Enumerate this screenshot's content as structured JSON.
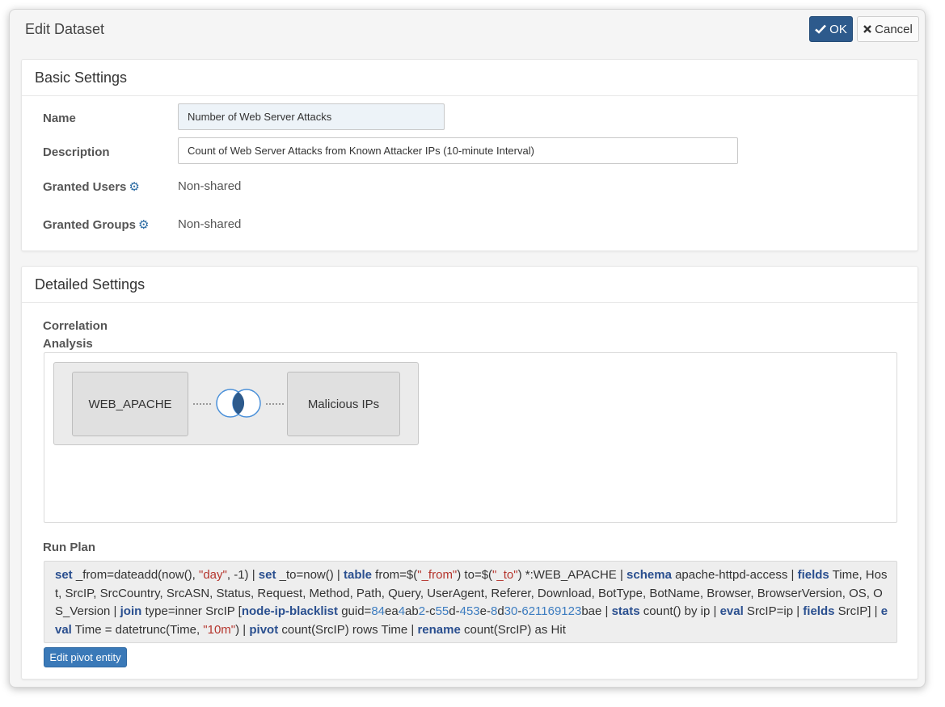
{
  "dialog": {
    "title": "Edit Dataset",
    "ok_label": "OK",
    "cancel_label": "Cancel"
  },
  "basic": {
    "heading": "Basic Settings",
    "name_label": "Name",
    "name_value": "Number of Web Server Attacks",
    "description_label": "Description",
    "description_value": "Count of Web Server Attacks from Known Attacker IPs (10-minute Interval)",
    "granted_users_label": "Granted Users",
    "granted_users_value": "Non-shared",
    "granted_groups_label": "Granted Groups",
    "granted_groups_value": "Non-shared"
  },
  "detailed": {
    "heading": "Detailed Settings",
    "correlation_label_1": "Correlation",
    "correlation_label_2": "Analysis",
    "left_source": "WEB_APACHE",
    "right_source": "Malicious IPs",
    "run_plan_label": "Run Plan",
    "run_plan_segments": [
      {
        "t": "set",
        "k": "kw"
      },
      {
        "t": " _from=dateadd(now(), ",
        "k": ""
      },
      {
        "t": "\"day\"",
        "k": "str"
      },
      {
        "t": ", -1) | ",
        "k": ""
      },
      {
        "t": "set",
        "k": "kw"
      },
      {
        "t": " _to=now() | ",
        "k": ""
      },
      {
        "t": "table",
        "k": "kw"
      },
      {
        "t": " from=$(",
        "k": ""
      },
      {
        "t": "\"_from\"",
        "k": "str"
      },
      {
        "t": ") to=$(",
        "k": ""
      },
      {
        "t": "\"_to\"",
        "k": "str"
      },
      {
        "t": ") *:WEB_APACHE | ",
        "k": ""
      },
      {
        "t": "schema",
        "k": "kw"
      },
      {
        "t": " apache-httpd-access | ",
        "k": ""
      },
      {
        "t": "fields",
        "k": "kw"
      },
      {
        "t": " Time, Host, SrcIP, SrcCountry, SrcASN, Status, Request, Method, Path, Query, UserAgent, Referer, Download, BotType, BotName, Browser, BrowserVersion, OS, OS_Version  | ",
        "k": ""
      },
      {
        "t": "join",
        "k": "kw"
      },
      {
        "t": " type=inner SrcIP [",
        "k": ""
      },
      {
        "t": "node-ip-blacklist",
        "k": "kw"
      },
      {
        "t": " guid=",
        "k": ""
      },
      {
        "t": "84",
        "k": "num"
      },
      {
        "t": "ea",
        "k": ""
      },
      {
        "t": "4",
        "k": "num"
      },
      {
        "t": "ab",
        "k": ""
      },
      {
        "t": "2",
        "k": "num"
      },
      {
        "t": "-c",
        "k": ""
      },
      {
        "t": "55",
        "k": "num"
      },
      {
        "t": "d-",
        "k": ""
      },
      {
        "t": "453",
        "k": "num"
      },
      {
        "t": "e-",
        "k": ""
      },
      {
        "t": "8",
        "k": "num"
      },
      {
        "t": "d",
        "k": ""
      },
      {
        "t": "30",
        "k": "num"
      },
      {
        "t": "-",
        "k": ""
      },
      {
        "t": "621169123",
        "k": "num"
      },
      {
        "t": "bae | ",
        "k": ""
      },
      {
        "t": "stats",
        "k": "kw"
      },
      {
        "t": " count() by ip | ",
        "k": ""
      },
      {
        "t": "eval",
        "k": "kw"
      },
      {
        "t": " SrcIP=ip | ",
        "k": ""
      },
      {
        "t": "fields",
        "k": "kw"
      },
      {
        "t": " SrcIP] | ",
        "k": ""
      },
      {
        "t": "eval",
        "k": "kw"
      },
      {
        "t": " Time = datetrunc(Time, ",
        "k": ""
      },
      {
        "t": "\"10m\"",
        "k": "str"
      },
      {
        "t": ")  | ",
        "k": ""
      },
      {
        "t": "pivot",
        "k": "kw"
      },
      {
        "t": " count(SrcIP) rows Time | ",
        "k": ""
      },
      {
        "t": "rename",
        "k": "kw"
      },
      {
        "t": " count(SrcIP) as Hit",
        "k": ""
      }
    ],
    "edit_pivot_label": "Edit pivot entity"
  },
  "colors": {
    "primary": "#2d5a8c",
    "keyword": "#2a4f8f",
    "string": "#b5352d",
    "number": "#3c7cc0",
    "gear": "#2e6da4"
  }
}
